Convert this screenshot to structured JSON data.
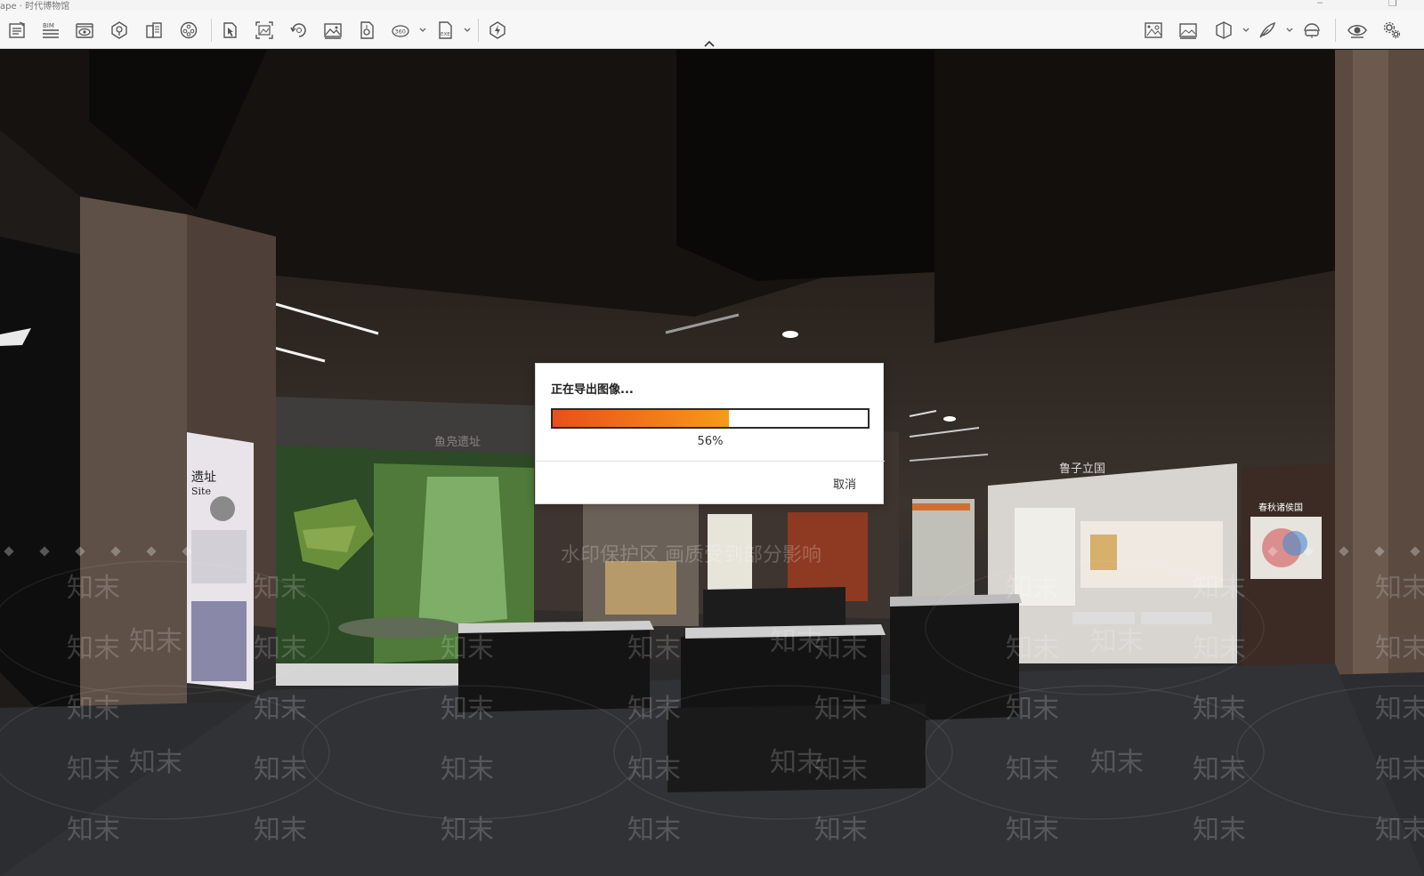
{
  "window": {
    "title": "ape · 时代博物馆",
    "controls": [
      "–",
      "❐"
    ]
  },
  "toolbar": {
    "collapse_icon": "chevron-up-icon",
    "groups": [
      {
        "name": "left",
        "items": [
          "notes-icon",
          "bim-icon",
          "view-icon",
          "model-icon",
          "materials-icon",
          "settings-wheel-icon"
        ]
      },
      {
        "name": "export",
        "items": [
          "pointer-file-icon",
          "image-frame-icon",
          "rotate-icon",
          "picture-icon",
          "file-icon",
          "panorama-360-icon",
          "exe-export-icon",
          "lightning-icon"
        ]
      },
      {
        "name": "right",
        "items": [
          "scene-icon",
          "image-icon",
          "section-box-icon",
          "feather-icon",
          "vr-headset-icon",
          "eye-icon",
          "gears-icon"
        ]
      }
    ],
    "bim_label": "BIM",
    "panorama_label": "360",
    "exe_label": "EXE"
  },
  "viewport": {
    "scene_description_icon": "museum-render-icon",
    "wall_panels": {
      "site_title": "遗址",
      "site_sub": "Site",
      "banner_center": "鱼凫遗址",
      "panel_mid": "鲁子立国",
      "panel_right": "春秋诸侯国"
    },
    "watermark_repeat": "知末",
    "watermark_center": "水印保护区 画质受到部分影响"
  },
  "export_dialog": {
    "title": "正在导出图像...",
    "progress_percent": 56,
    "progress_label": "56%",
    "cancel_label": "取消",
    "colors": {
      "progress_start": "#e8501a",
      "progress_end": "#f79a1a"
    }
  }
}
